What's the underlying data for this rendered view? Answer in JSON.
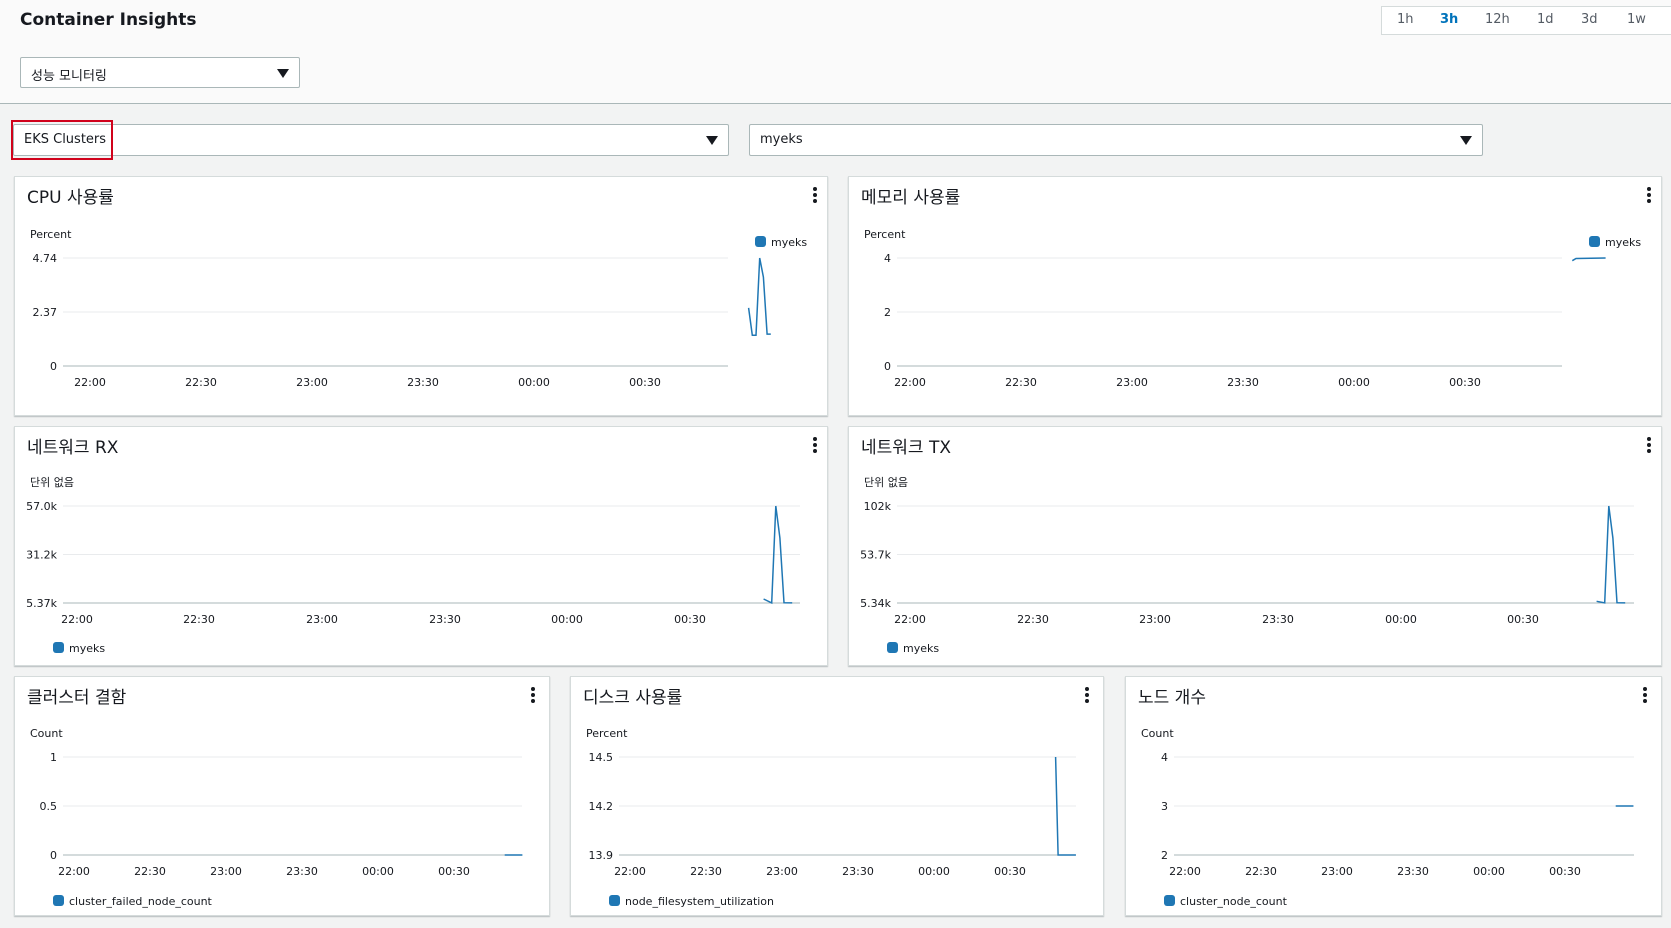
{
  "header": {
    "title": "Container Insights",
    "time_ranges": [
      "1h",
      "3h",
      "12h",
      "1d",
      "3d",
      "1w"
    ],
    "active_range": "3h",
    "view_select": "성능 모니터링"
  },
  "filters": {
    "resource_type": "EKS Clusters",
    "cluster": "myeks"
  },
  "colors": {
    "series": "#1f77b4",
    "highlight": "#d0021b",
    "active_range": "#0073bb"
  },
  "panels": [
    {
      "title": "CPU 사용률",
      "chart_data": {
        "type": "line",
        "title": "CPU 사용률",
        "ylabel": "Percent",
        "xlabel": "",
        "x_ticks": [
          "22:00",
          "22:30",
          "23:00",
          "23:30",
          "00:00",
          "00:30"
        ],
        "y_ticks": [
          "0",
          "2.37",
          "4.74"
        ],
        "ylim": [
          0,
          4.74
        ],
        "legend_position": "top-right",
        "series": [
          {
            "name": "myeks",
            "x": [
              "00:58",
              "00:59",
              "01:00",
              "01:01",
              "01:02",
              "01:03",
              "01:04"
            ],
            "y": [
              2.55,
              1.35,
              1.35,
              4.74,
              3.9,
              1.4,
              1.4
            ]
          }
        ]
      }
    },
    {
      "title": "메모리 사용률",
      "chart_data": {
        "type": "line",
        "title": "메모리 사용률",
        "ylabel": "Percent",
        "xlabel": "",
        "x_ticks": [
          "22:00",
          "22:30",
          "23:00",
          "23:30",
          "00:00",
          "00:30"
        ],
        "y_ticks": [
          "0",
          "2",
          "4"
        ],
        "ylim": [
          0,
          4
        ],
        "legend_position": "top-right",
        "series": [
          {
            "name": "myeks",
            "x": [
              "00:59",
              "01:00",
              "01:08"
            ],
            "y": [
              3.9,
              3.98,
              4.0
            ]
          }
        ]
      }
    },
    {
      "title": "네트워크 RX",
      "chart_data": {
        "type": "line",
        "title": "네트워크 RX",
        "ylabel": "단위 없음",
        "xlabel": "",
        "x_ticks": [
          "22:00",
          "22:30",
          "23:00",
          "23:30",
          "00:00",
          "00:30"
        ],
        "y_ticks": [
          "5.37k",
          "31.2k",
          "57.0k"
        ],
        "ylim": [
          5370,
          57000
        ],
        "legend_position": "bottom-left",
        "series": [
          {
            "name": "myeks",
            "x": [
              "00:48",
              "00:50",
              "00:51",
              "00:52",
              "00:53",
              "00:55"
            ],
            "y": [
              7500,
              5400,
              57000,
              40000,
              5500,
              5400
            ]
          }
        ]
      }
    },
    {
      "title": "네트워크 TX",
      "chart_data": {
        "type": "line",
        "title": "네트워크 TX",
        "ylabel": "단위 없음",
        "xlabel": "",
        "x_ticks": [
          "22:00",
          "22:30",
          "23:00",
          "23:30",
          "00:00",
          "00:30"
        ],
        "y_ticks": [
          "5.34k",
          "53.7k",
          "102k"
        ],
        "ylim": [
          5340,
          102000
        ],
        "legend_position": "bottom-left",
        "series": [
          {
            "name": "myeks",
            "x": [
              "00:48",
              "00:50",
              "00:51",
              "00:52",
              "00:53",
              "00:55"
            ],
            "y": [
              7000,
              5400,
              102000,
              70000,
              5500,
              5400
            ]
          }
        ]
      }
    },
    {
      "title": "클러스터 결함",
      "chart_data": {
        "type": "line",
        "title": "클러스터 결함",
        "ylabel": "Count",
        "xlabel": "",
        "x_ticks": [
          "22:00",
          "22:30",
          "23:00",
          "23:30",
          "00:00",
          "00:30"
        ],
        "y_ticks": [
          "0",
          "0.5",
          "1"
        ],
        "ylim": [
          0,
          1
        ],
        "legend_position": "bottom-left",
        "series": [
          {
            "name": "cluster_failed_node_count",
            "x": [
              "00:50",
              "00:57"
            ],
            "y": [
              0,
              0
            ]
          }
        ]
      }
    },
    {
      "title": "디스크 사용률",
      "chart_data": {
        "type": "line",
        "title": "디스크 사용률",
        "ylabel": "Percent",
        "xlabel": "",
        "x_ticks": [
          "22:00",
          "22:30",
          "23:00",
          "23:30",
          "00:00",
          "00:30"
        ],
        "y_ticks": [
          "13.9",
          "14.2",
          "14.5"
        ],
        "ylim": [
          13.9,
          14.5
        ],
        "legend_position": "bottom-left",
        "series": [
          {
            "name": "node_filesystem_utilization",
            "x": [
              "00:48",
              "00:49",
              "00:56"
            ],
            "y": [
              14.5,
              13.9,
              13.9
            ]
          }
        ]
      }
    },
    {
      "title": "노드 개수",
      "chart_data": {
        "type": "line",
        "title": "노드 개수",
        "ylabel": "Count",
        "xlabel": "",
        "x_ticks": [
          "22:00",
          "22:30",
          "23:00",
          "23:30",
          "00:00",
          "00:30"
        ],
        "y_ticks": [
          "2",
          "3",
          "4"
        ],
        "ylim": [
          2,
          4
        ],
        "legend_position": "bottom-left",
        "series": [
          {
            "name": "cluster_node_count",
            "x": [
              "00:50",
              "00:57"
            ],
            "y": [
              3,
              3
            ]
          }
        ]
      }
    }
  ]
}
